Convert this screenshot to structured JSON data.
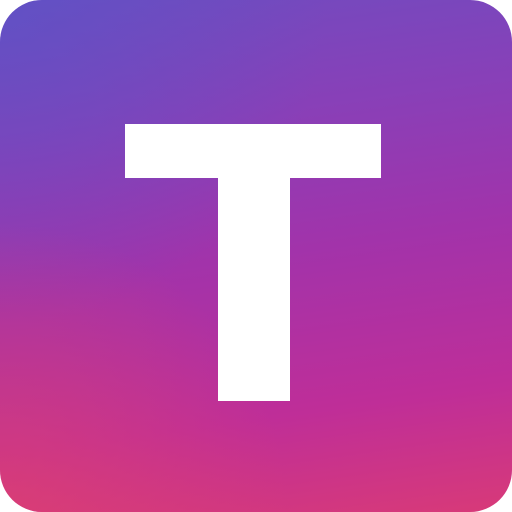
{
  "icon": {
    "letter": "T",
    "gradient_top": "#6f4cc0",
    "gradient_bottom": "#d83a78",
    "glyph_color": "#ffffff"
  }
}
